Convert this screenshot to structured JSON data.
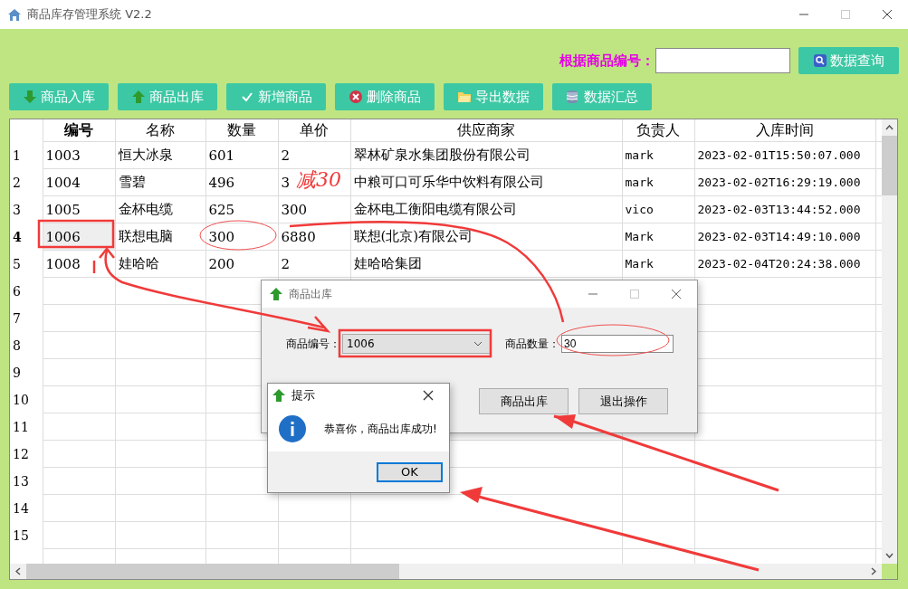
{
  "window": {
    "title": "商品库存管理系统 V2.2"
  },
  "search": {
    "label": "根据商品编号：",
    "button": "数据查询"
  },
  "toolbar": [
    "商品入库",
    "商品出库",
    "新增商品",
    "删除商品",
    "导出数据",
    "数据汇总"
  ],
  "table": {
    "columns": [
      "编号",
      "名称",
      "数量",
      "单价",
      "供应商家",
      "负责人",
      "入库时间"
    ],
    "rows": [
      {
        "number": "1",
        "selected": false,
        "cells": [
          "1003",
          "恒大冰泉",
          "601",
          "2",
          "翠林矿泉水集团股份有限公司",
          "mark",
          "2023-02-01T15:50:07.000"
        ]
      },
      {
        "number": "2",
        "selected": false,
        "cells": [
          "1004",
          "雪碧",
          "496",
          "3",
          "中粮可口可乐华中饮料有限公司",
          "mark",
          "2023-02-02T16:29:19.000"
        ]
      },
      {
        "number": "3",
        "selected": false,
        "cells": [
          "1005",
          "金杯电缆",
          "625",
          "300",
          "金杯电工衡阳电缆有限公司",
          "vico",
          "2023-02-03T13:44:52.000"
        ]
      },
      {
        "number": "4",
        "selected": true,
        "cells": [
          "1006",
          "联想电脑",
          "300",
          "6880",
          "联想(北京)有限公司",
          "Mark",
          "2023-02-03T14:49:10.000"
        ]
      },
      {
        "number": "5",
        "selected": false,
        "cells": [
          "1008",
          "娃哈哈",
          "200",
          "2",
          "娃哈哈集团",
          "Mark",
          "2023-02-04T20:24:38.000"
        ]
      },
      {
        "number": "6",
        "selected": false,
        "cells": []
      },
      {
        "number": "7",
        "selected": false,
        "cells": []
      },
      {
        "number": "8",
        "selected": false,
        "cells": []
      },
      {
        "number": "9",
        "selected": false,
        "cells": []
      },
      {
        "number": "10",
        "selected": false,
        "cells": []
      },
      {
        "number": "11",
        "selected": false,
        "cells": []
      },
      {
        "number": "12",
        "selected": false,
        "cells": []
      },
      {
        "number": "13",
        "selected": false,
        "cells": []
      },
      {
        "number": "14",
        "selected": false,
        "cells": []
      },
      {
        "number": "15",
        "selected": false,
        "cells": []
      }
    ]
  },
  "dialog": {
    "title": "商品出库",
    "fields": [
      {
        "label": "商品编号：",
        "value": "1006",
        "kind": "combo"
      },
      {
        "label": "商品数量：",
        "value": "30",
        "kind": "text"
      }
    ],
    "buttons": [
      "商品出库",
      "退出操作"
    ]
  },
  "message_box": {
    "title": "提示",
    "message": "恭喜你，商品出库成功!",
    "button": "OK"
  },
  "annotation": {
    "text": "减30"
  }
}
